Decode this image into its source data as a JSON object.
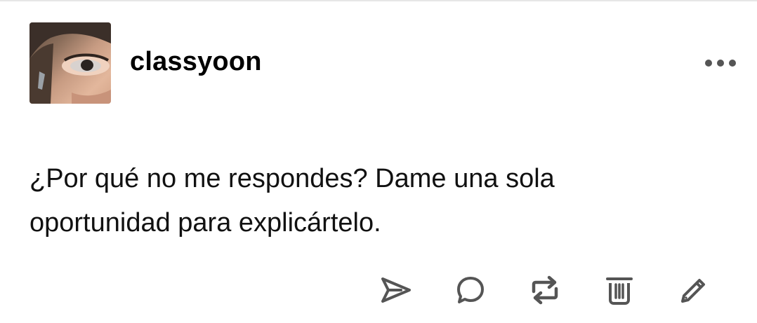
{
  "post": {
    "author": "classyoon",
    "text_lines": [
      "¿Por qué no me respondes? Dame una sola",
      "oportunidad para explicártelo."
    ]
  },
  "header": {
    "avatar_icon": "avatar-photo",
    "more_icon": "ellipsis-icon"
  },
  "actions": [
    {
      "icon": "send-icon"
    },
    {
      "icon": "reply-bubble-icon"
    },
    {
      "icon": "reblog-icon"
    },
    {
      "icon": "trash-icon"
    },
    {
      "icon": "edit-pencil-icon"
    }
  ],
  "colors": {
    "icon": "#555555",
    "text": "#111111",
    "divider": "#e6e6e6",
    "background": "#ffffff"
  }
}
